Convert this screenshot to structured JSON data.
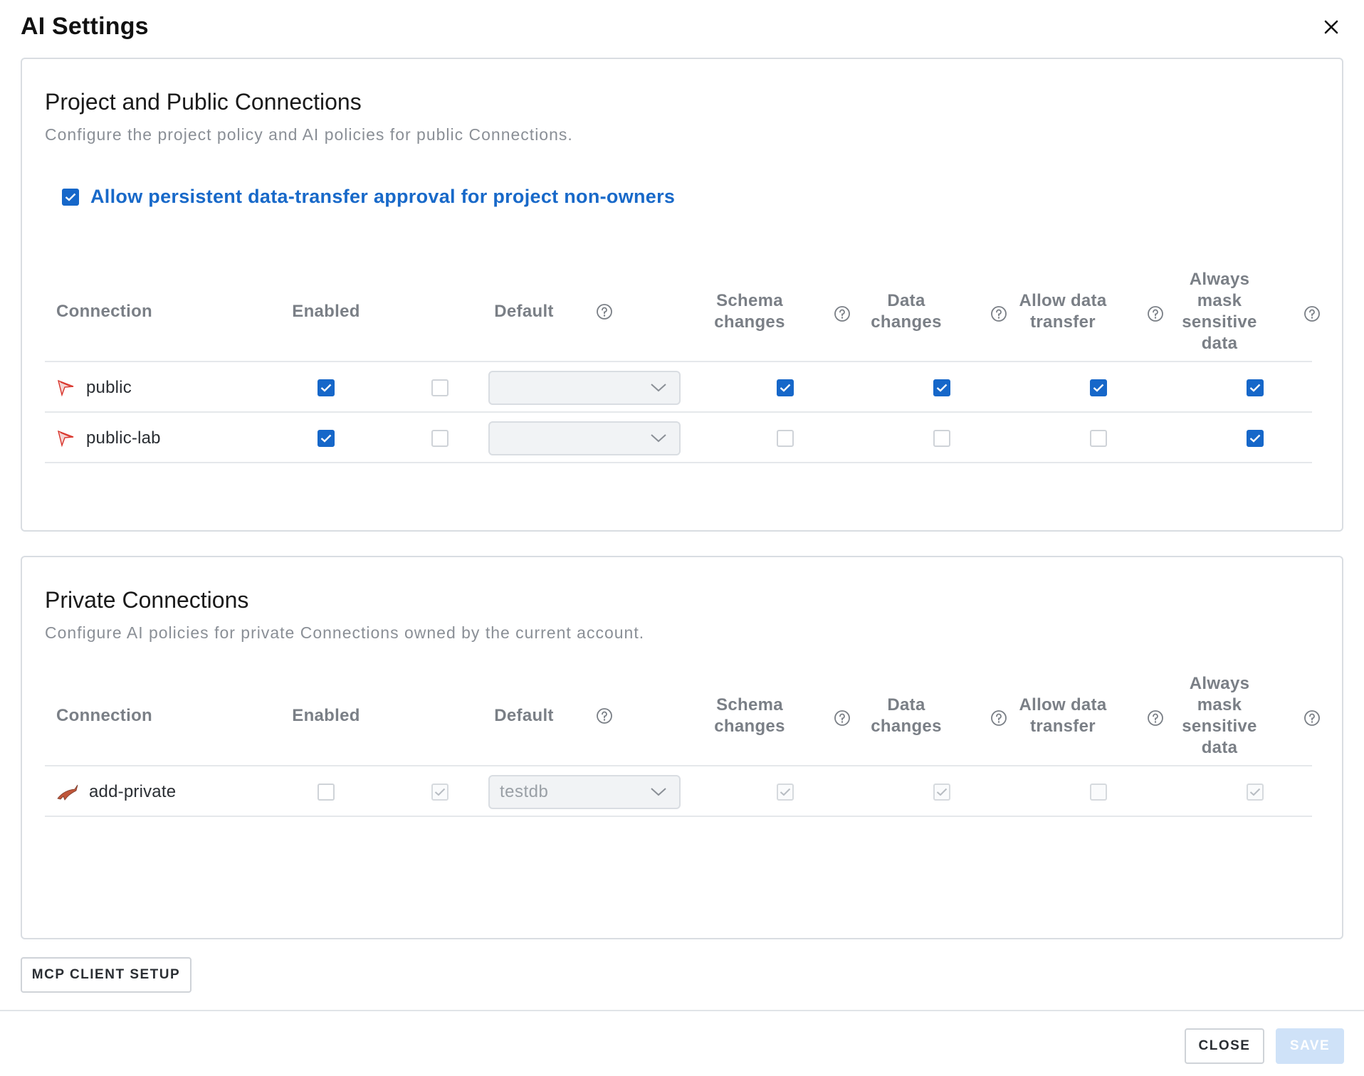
{
  "dialog": {
    "title": "AI Settings",
    "close_icon": "close-icon"
  },
  "project_section": {
    "title": "Project and Public Connections",
    "description": "Configure the project policy and AI policies for public Connections.",
    "allow_persistent": {
      "label": "Allow persistent data-transfer approval for project non-owners",
      "checked": true
    },
    "columns": {
      "connection": "Connection",
      "enabled": "Enabled",
      "default": "Default",
      "schema_line1": "Schema",
      "schema_line2": "changes",
      "data_line1": "Data",
      "data_line2": "changes",
      "transfer_line1": "Allow data",
      "transfer_line2": "transfer",
      "mask_line1": "Always",
      "mask_line2": "mask",
      "mask_line3": "sensitive",
      "mask_line4": "data"
    },
    "rows": [
      {
        "name": "public",
        "icon": "bird-icon",
        "enabled": true,
        "default_checked": false,
        "default_value": "",
        "schema_changes": true,
        "data_changes": true,
        "allow_data_transfer": true,
        "always_mask": true
      },
      {
        "name": "public-lab",
        "icon": "bird-icon",
        "enabled": true,
        "default_checked": false,
        "default_value": "",
        "schema_changes": false,
        "data_changes": false,
        "allow_data_transfer": false,
        "always_mask": true
      }
    ]
  },
  "private_section": {
    "title": "Private Connections",
    "description": "Configure AI policies for private Connections owned by the current account.",
    "columns": {
      "connection": "Connection",
      "enabled": "Enabled",
      "default": "Default",
      "schema_line1": "Schema",
      "schema_line2": "changes",
      "data_line1": "Data",
      "data_line2": "changes",
      "transfer_line1": "Allow data",
      "transfer_line2": "transfer",
      "mask_line1": "Always",
      "mask_line2": "mask",
      "mask_line3": "sensitive",
      "mask_line4": "data"
    },
    "rows": [
      {
        "name": "add-private",
        "icon": "dolphin-icon",
        "enabled": false,
        "default_checked": true,
        "default_value": "testdb",
        "schema_changes": true,
        "data_changes": true,
        "allow_data_transfer": false,
        "always_mask": true
      }
    ]
  },
  "buttons": {
    "mcp_setup": "MCP CLIENT SETUP",
    "close": "CLOSE",
    "save": "SAVE"
  },
  "colors": {
    "accent": "#1667c9",
    "link_text": "#1869c9",
    "save_disabled_bg": "#cfe2f8",
    "border": "#d9dde2",
    "muted_text": "#8a8f96"
  }
}
